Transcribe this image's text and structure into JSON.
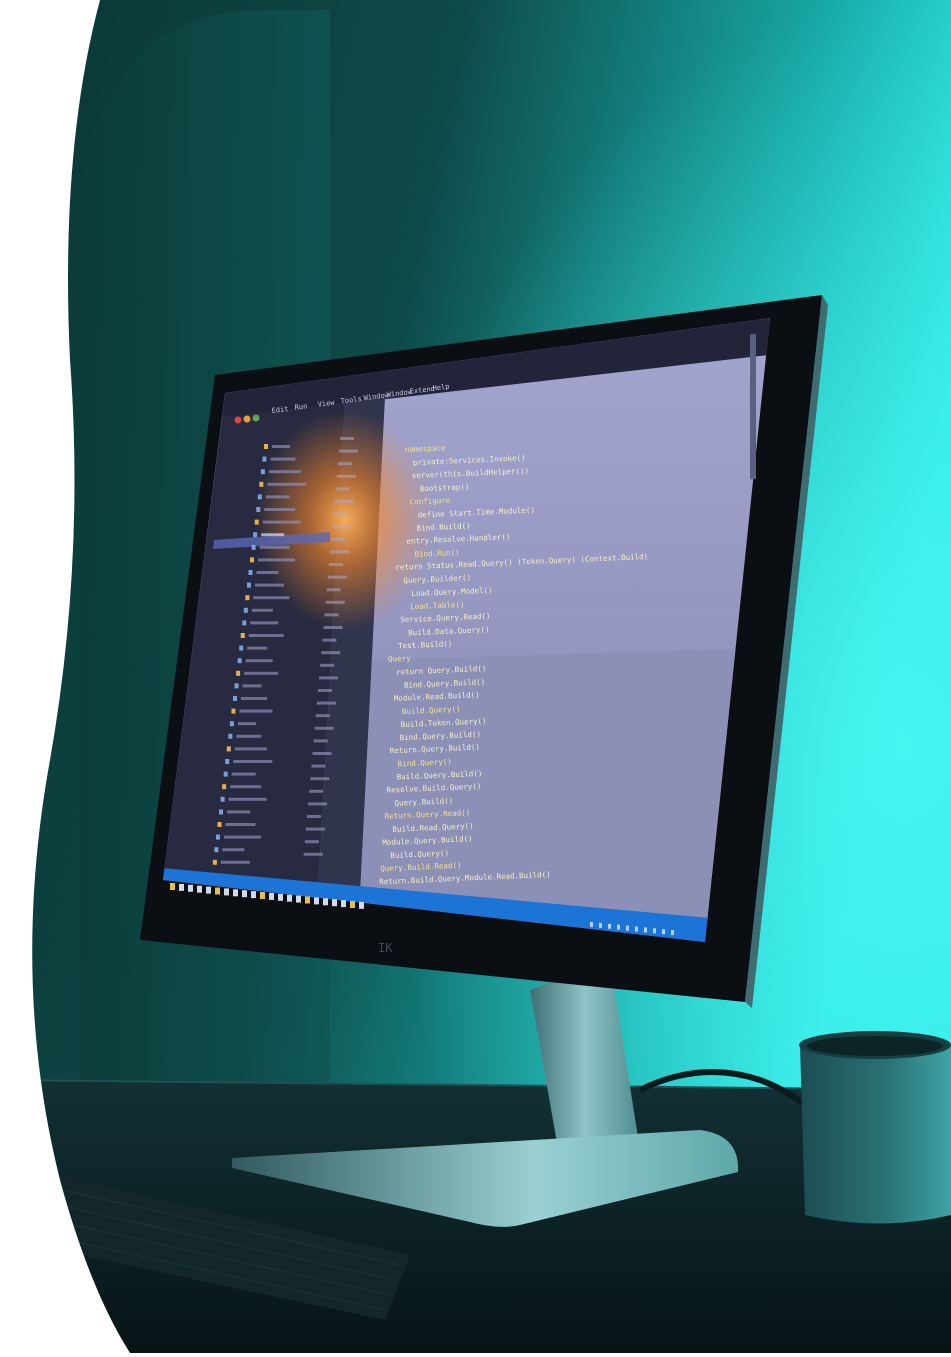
{
  "scene": {
    "description_type": "photo",
    "colors": {
      "wall_dark": "#08302f",
      "wall_glow": "#22d6d2",
      "desk": "#0c1f22",
      "screen_bg": "#9a9dc4",
      "sidebar_bg": "#272a40",
      "taskbar": "#1b74d6",
      "code_yellow": "#f2e38a",
      "highlight_orange": "#ff8a2a"
    }
  },
  "monitor": {
    "brand_mark": "IK",
    "menu_items": [
      "Edit",
      "Run",
      "View",
      "Tools",
      "Window",
      "Window",
      "Extend",
      "Help"
    ]
  },
  "editor": {
    "code_lines": [
      "namespace",
      "  private:Services.Invoke()",
      "  server(this.BuildHelper())",
      "    Bootstrap()",
      "  Configure",
      "    define Start.Time.Module()",
      "    Bind.Build()",
      "  entry.Resolve.Handler()",
      "    Bind.Run()",
      "return Status.Read.Query() (Token.Query) (Context.Build)",
      "  Query.Builder()",
      "    Load.Query.Model()",
      "    Load.Table()",
      "  Service.Query.Read()",
      "    Build.Data.Query()",
      "  Test.Build()",
      "Query",
      "  return Query.Build()",
      "    Bind.Query.Build()",
      "  Module.Read.Build()",
      "    Build.Query()",
      "    Build.Token.Query()",
      "    Bind.Query.Build()",
      "  Return.Query.Build()",
      "    Bind.Query()",
      "    Build.Query.Build()",
      "  Resolve.Build.Query()",
      "    Query.Build()",
      "  Return.Query.Read()",
      "    Build.Read.Query()",
      "  Module.Query.Build()",
      "    Build.Query()",
      "  Query.Build.Read()",
      "  Return.Build.Query.Module.Read.Build()"
    ]
  }
}
